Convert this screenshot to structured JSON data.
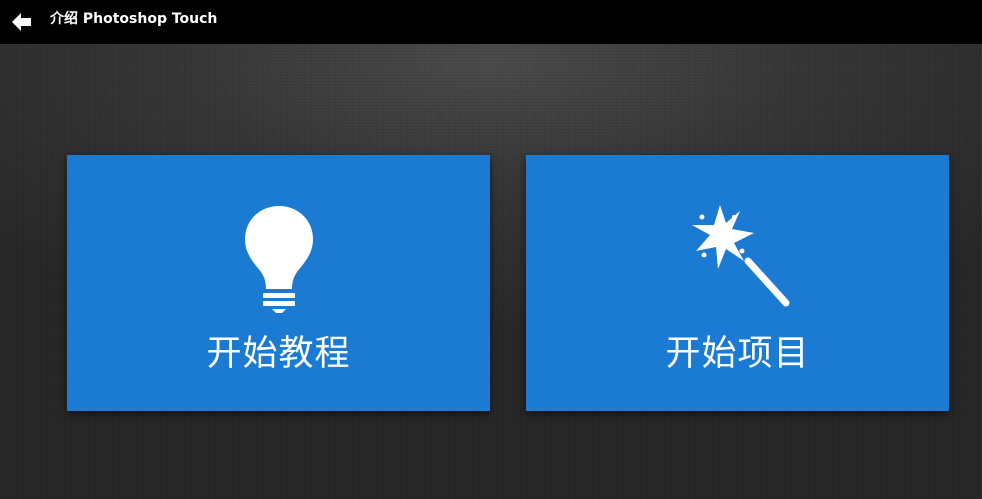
{
  "header": {
    "title": "介绍 Photoshop Touch",
    "back_icon": "arrow-left-icon"
  },
  "cards": [
    {
      "label": "开始教程",
      "icon": "lightbulb-icon"
    },
    {
      "label": "开始项目",
      "icon": "magic-wand-icon"
    }
  ],
  "colors": {
    "card_background": "#1b7ad1",
    "topbar_background": "#000000",
    "page_background": "#2e2e2e",
    "foreground": "#ffffff"
  }
}
